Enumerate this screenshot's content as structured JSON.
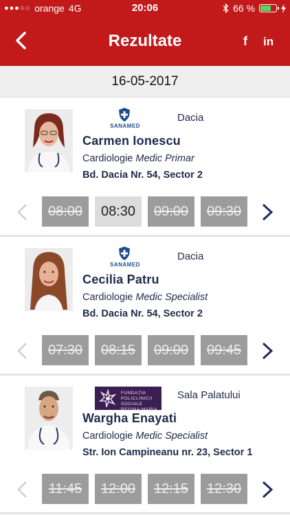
{
  "status": {
    "carrier": "orange",
    "network": "4G",
    "time": "20:06",
    "battery": "66 %",
    "battery_level_percent": 66
  },
  "nav": {
    "title": "Rezultate",
    "facebook": "f",
    "linkedin": "in"
  },
  "date": "16-05-2017",
  "colors": {
    "brand_red": "#c21a1a",
    "text_navy": "#1f2a4a",
    "slot_taken": "#9c9c9c",
    "slot_free": "#dcdcdc"
  },
  "doctors": [
    {
      "logo_text": "SANAMED",
      "location": "Dacia",
      "name": "Carmen Ionescu",
      "specialty": "Cardiologie",
      "rank": "Medic Primar",
      "address": "Bd. Dacia Nr. 54, Sector 2",
      "slots": [
        {
          "time": "08:00",
          "available": false
        },
        {
          "time": "08:30",
          "available": true
        },
        {
          "time": "09:00",
          "available": false
        },
        {
          "time": "09:30",
          "available": false
        }
      ]
    },
    {
      "logo_text": "SANAMED",
      "location": "Dacia",
      "name": "Cecilia Patru",
      "specialty": "Cardiologie",
      "rank": "Medic Specialist",
      "address": "Bd. Dacia Nr. 54, Sector 2",
      "slots": [
        {
          "time": "07:30",
          "available": false
        },
        {
          "time": "08:15",
          "available": false
        },
        {
          "time": "09:00",
          "available": false
        },
        {
          "time": "09:45",
          "available": false
        }
      ]
    },
    {
      "logo_text": "FUNDAȚIA POLICLINICII SOCIALE REGINA MARIA",
      "location": "Sala Palatului",
      "name": "Wargha Enayati",
      "specialty": "Cardiologie",
      "rank": "Medic Specialist",
      "address": "Str. Ion Campineanu nr. 23, Sector 1",
      "slots": [
        {
          "time": "11:45",
          "available": false
        },
        {
          "time": "12:00",
          "available": false
        },
        {
          "time": "12:15",
          "available": false
        },
        {
          "time": "12:30",
          "available": false
        }
      ]
    }
  ]
}
